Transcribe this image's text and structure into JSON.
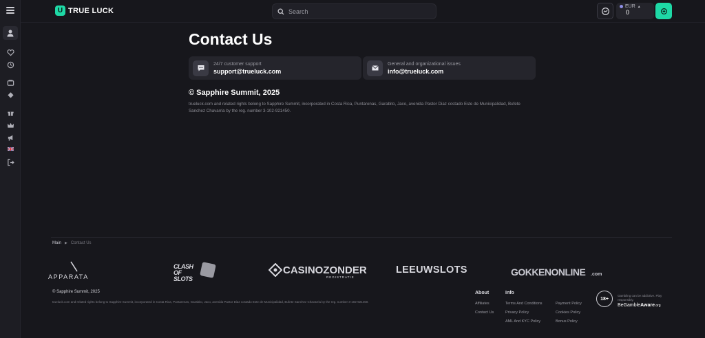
{
  "header": {
    "logo_text": "TRUE LUCK",
    "search_placeholder": "Search",
    "currency": "EUR",
    "balance": "0"
  },
  "main": {
    "title": "Contact Us",
    "cards": [
      {
        "sub": "24/7 customer support",
        "main": "support@trueluck.com"
      },
      {
        "sub": "General and organizational issues",
        "main": "info@trueluck.com"
      }
    ],
    "copyright_title": "© Sapphire Summit, 2025",
    "copyright_text": "trueluck.com and related rights belong to Sapphire Summit, incorporated in Costa Rica, Puntarenas, Garabito, Jaco, avenida Pastor Diaz costado Este de Municipalidad, Bufete Sanchez Chavarria by the reg. number 3-102-921450."
  },
  "footer": {
    "breadcrumb": [
      "Main",
      "Contact Us"
    ],
    "partners": [
      "APPARATA",
      "CLASH OF SLOTS",
      "CASINOZONDER",
      "REGISTRATIE",
      "LEEUWSLOTS",
      "GOKKENONLINE",
      ".com"
    ],
    "copyright": "© Sapphire Summit, 2025",
    "legal": "trueluck.com and related rights belong to Sapphire Summit, incorporated in Costa Rica, Puntarenas, Garabito, Jaco, avenida Pastor Diaz costado Este de Municipalidad, Bufete Sanchez Chavarria by the reg. number 3-102-921450.",
    "about_title": "About",
    "about_links": [
      "Affiliates",
      "Contact Us"
    ],
    "info_title": "Info",
    "info_col1": [
      "Terms And Conditions",
      "Privacy Policy",
      "AML And KYC Policy"
    ],
    "info_col2": [
      "Payment Policy",
      "Cookies Policy",
      "Bonus Policy"
    ],
    "age": "18+",
    "gamble_note": "Gambling can be addictive. Play responsibly.",
    "gamble_aware_a": "BeGamble",
    "gamble_aware_b": "Aware",
    "gamble_aware_c": ".org"
  },
  "colors": {
    "accent": "#1ed9a6",
    "bg": "#17171c",
    "card": "#25252c"
  },
  "sidebar_icons": [
    "menu-icon",
    "user-icon",
    "heart-icon",
    "history-icon",
    "casino-icon",
    "diamond-icon",
    "gift-icon",
    "crown-icon",
    "megaphone-icon",
    "uk-flag-icon",
    "logout-icon"
  ]
}
